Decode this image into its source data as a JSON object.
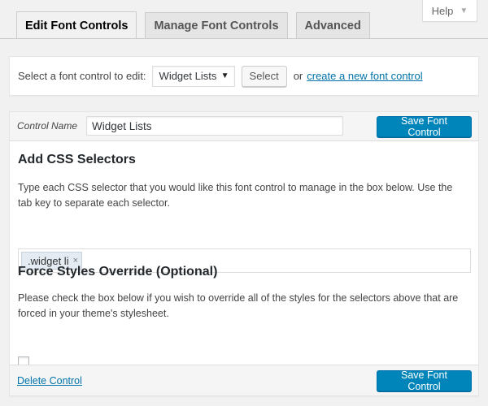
{
  "help": {
    "label": "Help",
    "caret_icon": "caret-down-icon"
  },
  "tabs": [
    {
      "label": "Edit Font Controls",
      "active": true
    },
    {
      "label": "Manage Font Controls",
      "active": false
    },
    {
      "label": "Advanced",
      "active": false
    }
  ],
  "selector_bar": {
    "label": "Select a font control to edit:",
    "dropdown_value": "Widget Lists",
    "select_button": "Select",
    "or_text": "or",
    "create_link": "create a new font control"
  },
  "editor": {
    "control_name_label": "Control Name",
    "control_name_value": "Widget Lists",
    "save_button": "Save Font Control",
    "css_heading": "Add CSS Selectors",
    "css_description": "Type each CSS selector that you would like this font control to manage in the box below. Use the tab key to separate each selector.",
    "selectors": [
      ".widget li"
    ],
    "force_heading": "Force Styles Override (Optional)",
    "force_description": "Please check the box below if you wish to override all of the styles for the selectors above that are forced in your theme's stylesheet.",
    "force_checked": false,
    "delete_link": "Delete Control",
    "footer_save_button": "Save Font Control"
  },
  "colors": {
    "primary": "#0085ba",
    "link": "#0073aa",
    "background": "#f1f1f1"
  }
}
